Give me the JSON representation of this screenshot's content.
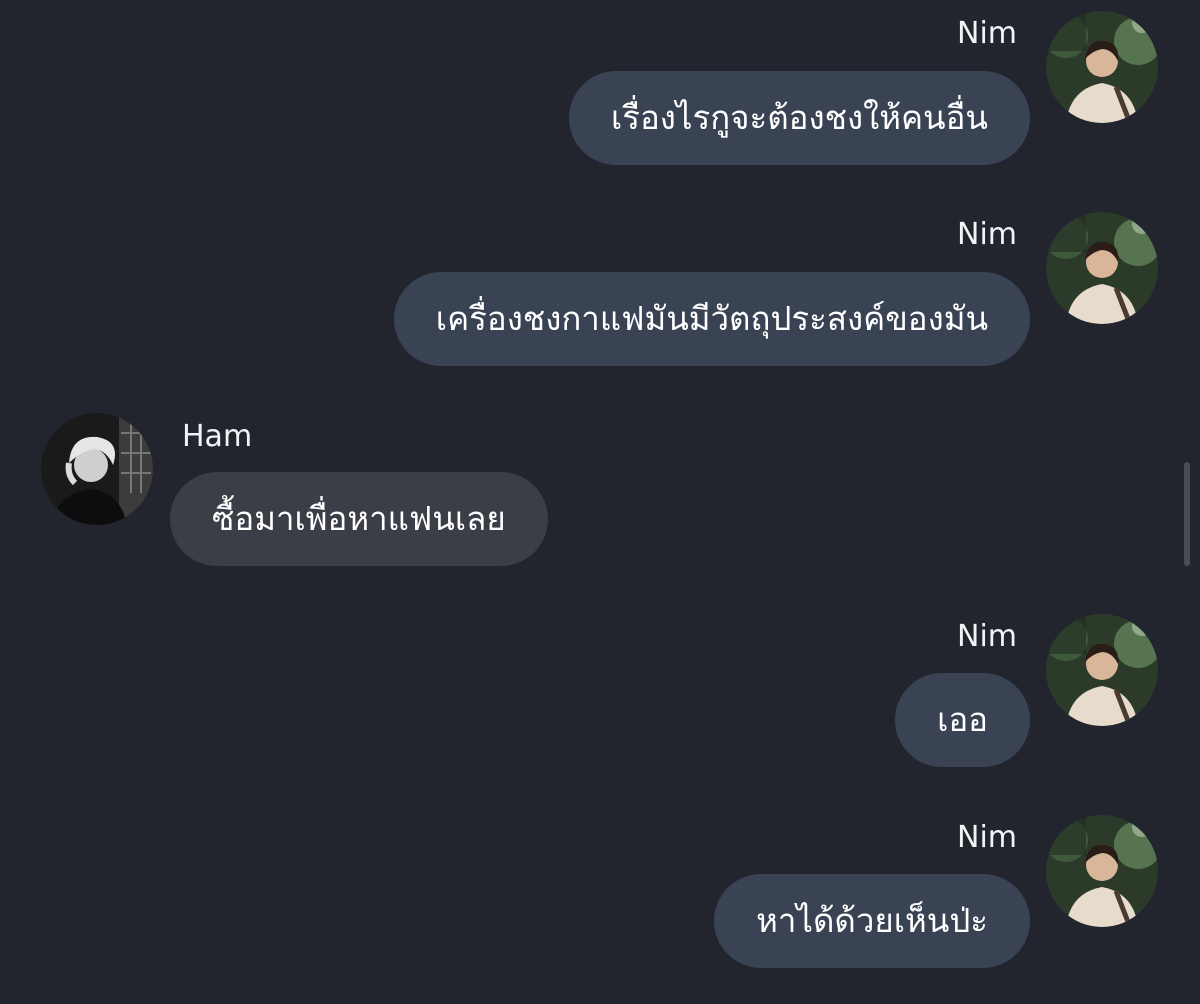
{
  "messages": [
    {
      "sender": "Nim",
      "text": "เรื่องไรกูจะต้องชงให้คนอื่น"
    },
    {
      "sender": "Nim",
      "text": "เครื่องชงกาแฟมันมีวัตถุประสงค์ของมัน"
    },
    {
      "sender": "Ham",
      "text": "ซื้อมาเพื่อหาแฟนเลย"
    },
    {
      "sender": "Nim",
      "text": "เออ"
    },
    {
      "sender": "Nim",
      "text": "หาได้ด้วยเห็นป่ะ"
    }
  ],
  "colors": {
    "background": "#22252e",
    "outgoing_bubble": "#3a4354",
    "incoming_bubble": "#3b3e47",
    "text": "#ffffff"
  },
  "icons": {
    "nim_avatar": "user-avatar-photo",
    "ham_avatar": "user-avatar-photo-grayscale"
  }
}
